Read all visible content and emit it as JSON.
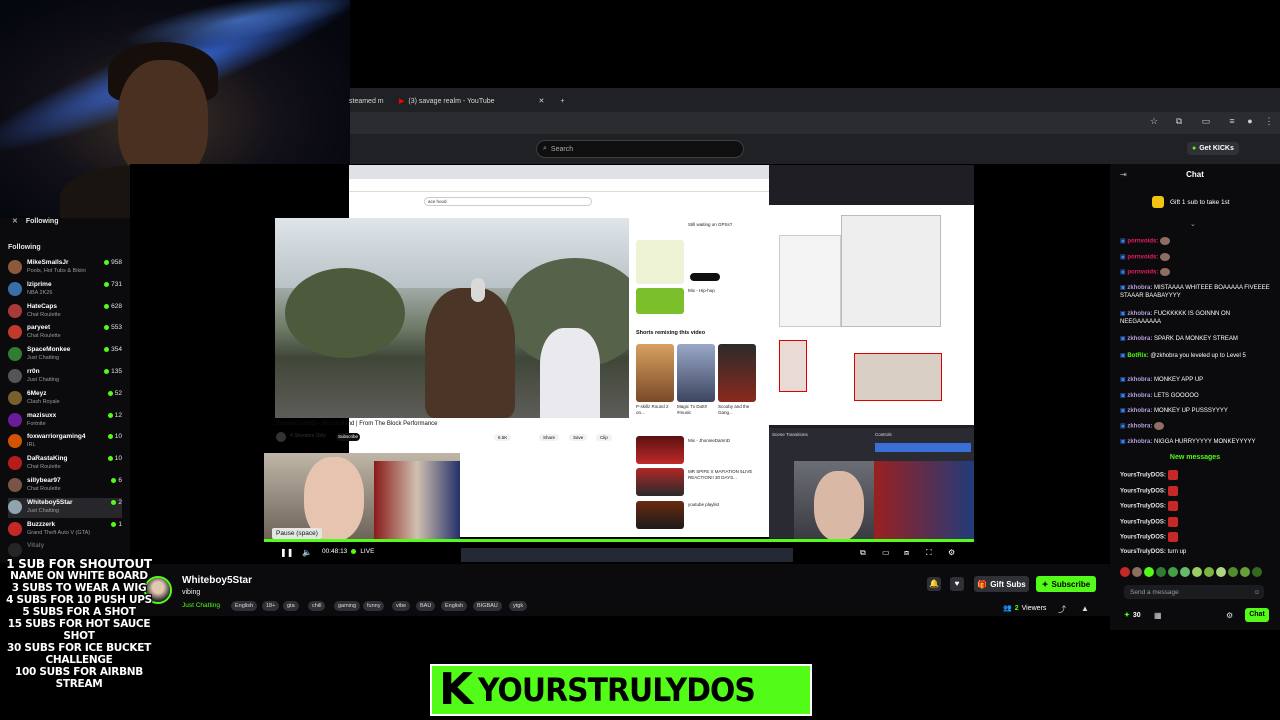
{
  "browser": {
    "tabs": [
      {
        "label": "steamed m"
      },
      {
        "label": "(3) savage realm - YouTube"
      }
    ],
    "search_placeholder": "Search",
    "get_kicks": "Get KICKs"
  },
  "sidebar": {
    "section_title": "Following",
    "list_title": "Following",
    "items": [
      {
        "name": "MikeSmallsJr",
        "category": "Pools, Hot Tubs & Bikini",
        "viewers": "958",
        "color": "#8a5a3a"
      },
      {
        "name": "Iziprime",
        "category": "NBA 2K26",
        "viewers": "731",
        "color": "#3a6ea8"
      },
      {
        "name": "HateCaps",
        "category": "Chat Roulette",
        "viewers": "628",
        "color": "#a83a3a"
      },
      {
        "name": "paryeet",
        "category": "Chat Roulette",
        "viewers": "553",
        "color": "#c0392b"
      },
      {
        "name": "SpaceMonkee",
        "category": "Just Chatting",
        "viewers": "354",
        "color": "#2e7d32"
      },
      {
        "name": "rr0n",
        "category": "Just Chatting",
        "viewers": "135",
        "color": "#555"
      },
      {
        "name": "6Meyz",
        "category": "Clash Royale",
        "viewers": "52",
        "color": "#7b5e2e"
      },
      {
        "name": "mazisuxx",
        "category": "Fortnite",
        "viewers": "12",
        "color": "#6a1b9a"
      },
      {
        "name": "foxwarriorgaming4",
        "category": "IRL",
        "viewers": "10",
        "color": "#d35400"
      },
      {
        "name": "DaRastaKing",
        "category": "Chat Roulette",
        "viewers": "10",
        "color": "#b71c1c"
      },
      {
        "name": "sillybear97",
        "category": "Chat Roulette",
        "viewers": "6",
        "color": "#795548"
      },
      {
        "name": "Whiteboy5Star",
        "category": "Just Chatting",
        "viewers": "2",
        "color": "#90a4ae"
      },
      {
        "name": "Buzzzerk",
        "category": "Grand Theft Auto V (GTA)",
        "viewers": "1",
        "color": "#c62828"
      },
      {
        "name": "Vitaly",
        "category": "",
        "viewers": "",
        "color": "#555"
      }
    ]
  },
  "player": {
    "tooltip": "Pause (space)",
    "time": "00:48:13",
    "live": "LIVE"
  },
  "inner_youtube": {
    "search": "ace hood",
    "video_title": "JhonnieDamnD - Murda Bend | From The Block Performance",
    "channel": "4 Shooters Only",
    "subscribe": "Subscribe",
    "actions": [
      "6.5K",
      "Share",
      "Save",
      "Clip"
    ],
    "shorts_label": "Shorts remixing this video",
    "side_items": [
      "Still waiting on GPSs?",
      "Mix - Hip-hop",
      "P-skillz Round 2 on...",
      "Magic Tx Dutt!! #music",
      "Scooby and the Gang...",
      "Mix - JhonnieDamnD",
      "MR SPIFE X MAFIATION 5LIVE REACTION!! 30 DAYS...",
      "youtube playlist",
      "Mix - Jhonnie D..."
    ]
  },
  "chat": {
    "title": "Chat",
    "gift_banner": "Gift 1 sub to take 1st",
    "messages": [
      {
        "user": "pornvoids:",
        "text": "",
        "color": "#e91e63"
      },
      {
        "user": "pornvoids:",
        "text": "",
        "color": "#e91e63"
      },
      {
        "user": "pornvoids:",
        "text": "",
        "color": "#e91e63"
      },
      {
        "user": "zkhobra:",
        "text": "MISTAAAA WHITEEE BOAAAAA FIVEEEE STAAAR BAABAYYYY",
        "color": "#b39ddb"
      },
      {
        "user": "zkhobra:",
        "text": "FUCKKKKK IS GOINNN ON NEEGAAAAAA",
        "color": "#b39ddb"
      },
      {
        "user": "zkhobra:",
        "text": "SPARK DA MONKEY STREAM",
        "color": "#b39ddb"
      },
      {
        "user": "BotRix:",
        "text": "@zkhobra you leveled up to Level 5",
        "color": "#53fc18"
      },
      {
        "user": "zkhobra:",
        "text": "MONKEY APP UP",
        "color": "#b39ddb"
      },
      {
        "user": "zkhobra:",
        "text": "LETS GOOOOO",
        "color": "#b39ddb"
      },
      {
        "user": "zkhobra:",
        "text": "MONKEY UP PUSSSYYYY",
        "color": "#b39ddb"
      },
      {
        "user": "zkhobra:",
        "text": "",
        "color": "#b39ddb"
      },
      {
        "user": "zkhobra:",
        "text": "NIGGA HURRYYYYY MONKEYYYYY",
        "color": "#b39ddb"
      }
    ],
    "new_messages": "New messages",
    "recent": [
      {
        "user": "YoursTrulyDOS:",
        "text": ""
      },
      {
        "user": "YoursTrulyDOS:",
        "text": ""
      },
      {
        "user": "YoursTrulyDOS:",
        "text": ""
      },
      {
        "user": "YoursTrulyDOS:",
        "text": ""
      },
      {
        "user": "YoursTrulyDOS:",
        "text": ""
      },
      {
        "user": "YoursTrulyDOS:",
        "text": "turn up"
      }
    ],
    "send_placeholder": "Send a message",
    "points": "30",
    "send_button": "Chat"
  },
  "stream_info": {
    "channel": "Whiteboy5Star",
    "title": "vibing",
    "category": "Just Chatting",
    "tags": [
      "English",
      "18+",
      "gta",
      "chill",
      "gaming",
      "funny",
      "vibe",
      "BAU",
      "English",
      "BIGBAU",
      "ytgk"
    ],
    "gift_subs": "Gift Subs",
    "subscribe": "Subscribe",
    "viewers": "2",
    "viewers_label": "Viewers"
  },
  "overlay": {
    "goals": [
      "1 sub for shoutout",
      "name on white board",
      "3 subs to wear a wig",
      "4 subs for 10 push ups",
      "5 subs for a shot",
      "15 subs for hot sauce shot",
      "30 subs for ice bucket challenge",
      "100 subs for airbnb stream"
    ],
    "banner_k": "K",
    "banner_text": "YOURSTRULYDOS"
  },
  "colors": {
    "kick_green": "#53fc18",
    "panel_bg": "#0b0b0d"
  }
}
